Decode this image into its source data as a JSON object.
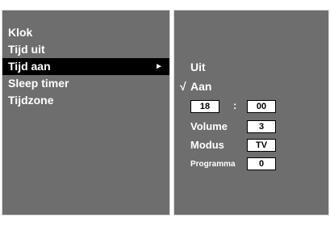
{
  "menu": {
    "items": [
      {
        "label": "Klok"
      },
      {
        "label": "Tijd uit"
      },
      {
        "label": "Tijd aan",
        "arrow": "►"
      },
      {
        "label": "Sleep timer"
      },
      {
        "label": "Tijdzone"
      }
    ]
  },
  "submenu": {
    "option_uit": "Uit",
    "check_mark": "√",
    "option_aan": "Aan",
    "hour": "18",
    "time_separator": ":",
    "minute": "00",
    "volume_label": "Volume",
    "volume_value": "3",
    "modus_label": "Modus",
    "modus_value": "TV",
    "programma_label": "Programma",
    "programma_value": "0"
  }
}
